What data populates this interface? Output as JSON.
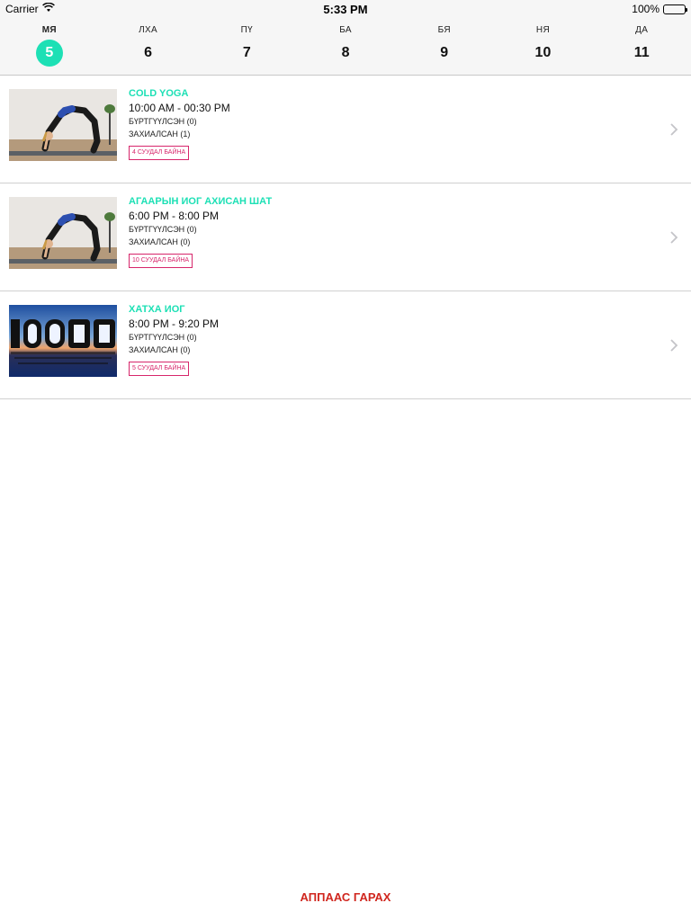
{
  "status_bar": {
    "carrier": "Carrier",
    "time": "5:33 PM",
    "battery": "100%"
  },
  "days": [
    {
      "label": "МЯ",
      "num": "5",
      "active": true
    },
    {
      "label": "ЛХА",
      "num": "6",
      "active": false
    },
    {
      "label": "ПҮ",
      "num": "7",
      "active": false
    },
    {
      "label": "БА",
      "num": "8",
      "active": false
    },
    {
      "label": "БЯ",
      "num": "9",
      "active": false
    },
    {
      "label": "НЯ",
      "num": "10",
      "active": false
    },
    {
      "label": "ДА",
      "num": "11",
      "active": false
    }
  ],
  "classes": [
    {
      "title": "COLD YOGA",
      "time": "10:00 AM - 00:30 PM",
      "registered": "БҮРТГҮҮЛСЭН (0)",
      "booked": "ЗАХИАЛСАН (1)",
      "badge": "4 СУУДАЛ БАЙНА",
      "image": "yoga-pose-photo"
    },
    {
      "title": "АГААРЫН ИОГ АХИСАН ШАТ",
      "time": "6:00 PM - 8:00 PM",
      "registered": "БҮРТГҮҮЛСЭН (0)",
      "booked": "ЗАХИАЛСАН (0)",
      "badge": "10 СУУДАЛ БАЙНА",
      "image": "yoga-pose-photo"
    },
    {
      "title": "ХАТХА ИОГ",
      "time": "8:00 PM - 9:20 PM",
      "registered": "БҮРТГҮҮЛСЭН (0)",
      "booked": "ЗАХИАЛСАН (0)",
      "badge": "5 СУУДАЛ БАЙНА",
      "image": "yoga-sunset-photo"
    }
  ],
  "logout_label": "АППААС ГАРАХ",
  "colors": {
    "accent": "#1de0b5",
    "badge": "#d7266b",
    "logout": "#d0261e"
  }
}
